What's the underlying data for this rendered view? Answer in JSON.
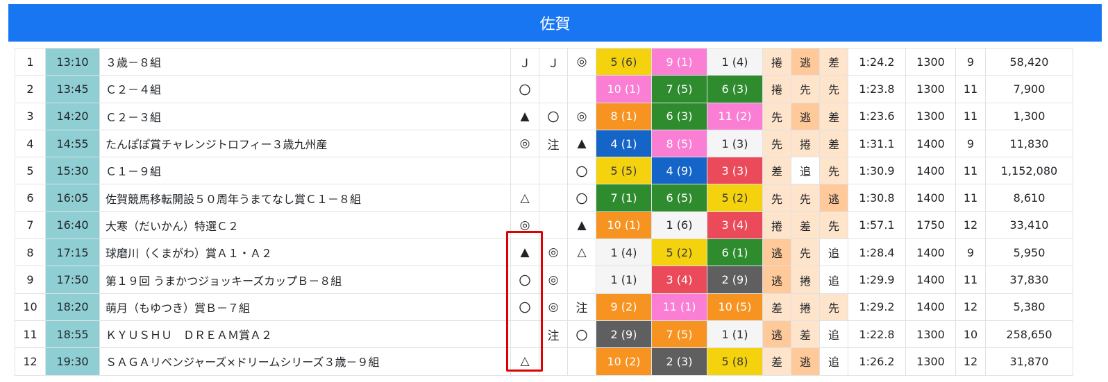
{
  "header": {
    "title": "佐賀"
  },
  "races": [
    {
      "no": "1",
      "time": "13:10",
      "name": "３歳－８組",
      "marks": [
        "Ｊ",
        "Ｊ",
        "◎"
      ],
      "results": [
        {
          "text": "5 (6)",
          "color": "yellow"
        },
        {
          "text": "9 (1)",
          "color": "pink"
        },
        {
          "text": "1 (4)",
          "color": "white"
        }
      ],
      "styles": [
        "捲",
        "逃",
        "差"
      ],
      "race_time": "1:24.2",
      "distance": "1300",
      "runners": "9",
      "payout": "58,420"
    },
    {
      "no": "2",
      "time": "13:45",
      "name": "Ｃ２－４組",
      "marks": [
        "〇",
        "",
        ""
      ],
      "results": [
        {
          "text": "10 (1)",
          "color": "pink"
        },
        {
          "text": "7 (5)",
          "color": "green"
        },
        {
          "text": "6 (3)",
          "color": "green"
        }
      ],
      "styles": [
        "捲",
        "先",
        "先"
      ],
      "race_time": "1:23.8",
      "distance": "1300",
      "runners": "11",
      "payout": "7,900"
    },
    {
      "no": "3",
      "time": "14:20",
      "name": "Ｃ２－３組",
      "marks": [
        "▲",
        "〇",
        "◎"
      ],
      "results": [
        {
          "text": "8 (1)",
          "color": "orange"
        },
        {
          "text": "6 (3)",
          "color": "green"
        },
        {
          "text": "11 (2)",
          "color": "pink"
        }
      ],
      "styles": [
        "先",
        "逃",
        "差"
      ],
      "race_time": "1:23.6",
      "distance": "1300",
      "runners": "11",
      "payout": "1,300"
    },
    {
      "no": "4",
      "time": "14:55",
      "name": "たんぽぽ賞チャレンジトロフィー３歳九州産",
      "marks": [
        "◎",
        "注",
        "▲"
      ],
      "results": [
        {
          "text": "4 (1)",
          "color": "blue"
        },
        {
          "text": "8 (5)",
          "color": "pink"
        },
        {
          "text": "1 (3)",
          "color": "white"
        }
      ],
      "styles": [
        "先",
        "捲",
        "差"
      ],
      "race_time": "1:31.1",
      "distance": "1400",
      "runners": "9",
      "payout": "11,830"
    },
    {
      "no": "5",
      "time": "15:30",
      "name": "Ｃ１－９組",
      "marks": [
        "",
        "",
        "〇"
      ],
      "results": [
        {
          "text": "5 (5)",
          "color": "yellow"
        },
        {
          "text": "4 (9)",
          "color": "blue"
        },
        {
          "text": "3 (3)",
          "color": "red"
        }
      ],
      "styles": [
        "差",
        "追",
        "先"
      ],
      "race_time": "1:30.9",
      "distance": "1400",
      "runners": "11",
      "payout": "1,152,080"
    },
    {
      "no": "6",
      "time": "16:05",
      "name": "佐賀競馬移転開設５０周年うまてなし賞Ｃ１－８組",
      "marks": [
        "△",
        "",
        "〇"
      ],
      "results": [
        {
          "text": "7 (1)",
          "color": "green"
        },
        {
          "text": "6 (5)",
          "color": "green"
        },
        {
          "text": "5 (2)",
          "color": "yellow"
        }
      ],
      "styles": [
        "先",
        "先",
        "逃"
      ],
      "race_time": "1:30.8",
      "distance": "1400",
      "runners": "11",
      "payout": "8,610"
    },
    {
      "no": "7",
      "time": "16:40",
      "name": "大寒（だいかん）特選Ｃ２",
      "marks": [
        "◎",
        "",
        "▲"
      ],
      "results": [
        {
          "text": "10 (1)",
          "color": "orange"
        },
        {
          "text": "1 (6)",
          "color": "white"
        },
        {
          "text": "3 (4)",
          "color": "red"
        }
      ],
      "styles": [
        "捲",
        "差",
        "先"
      ],
      "race_time": "1:57.1",
      "distance": "1750",
      "runners": "12",
      "payout": "33,410"
    },
    {
      "no": "8",
      "time": "17:15",
      "name": "球磨川（くまがわ）賞Ａ１・Ａ２",
      "marks": [
        "▲",
        "◎",
        "△"
      ],
      "results": [
        {
          "text": "1 (4)",
          "color": "white"
        },
        {
          "text": "5 (2)",
          "color": "yellow"
        },
        {
          "text": "6 (1)",
          "color": "green"
        }
      ],
      "styles": [
        "逃",
        "先",
        "追"
      ],
      "race_time": "1:28.4",
      "distance": "1400",
      "runners": "9",
      "payout": "5,950"
    },
    {
      "no": "9",
      "time": "17:50",
      "name": "第１９回 うまかつジョッキーズカップＢ－８組",
      "marks": [
        "〇",
        "◎",
        ""
      ],
      "results": [
        {
          "text": "1 (1)",
          "color": "white"
        },
        {
          "text": "3 (4)",
          "color": "red"
        },
        {
          "text": "2 (9)",
          "color": "gray"
        }
      ],
      "styles": [
        "逃",
        "捲",
        "追"
      ],
      "race_time": "1:29.9",
      "distance": "1400",
      "runners": "11",
      "payout": "37,830"
    },
    {
      "no": "10",
      "time": "18:20",
      "name": "萌月（もゆつき）賞Ｂ－７組",
      "marks": [
        "〇",
        "◎",
        "注"
      ],
      "results": [
        {
          "text": "9 (2)",
          "color": "orange"
        },
        {
          "text": "11 (1)",
          "color": "pink"
        },
        {
          "text": "10 (5)",
          "color": "orange"
        }
      ],
      "styles": [
        "差",
        "捲",
        "先"
      ],
      "race_time": "1:29.2",
      "distance": "1400",
      "runners": "12",
      "payout": "5,380"
    },
    {
      "no": "11",
      "time": "18:55",
      "name": "ＫＹＵＳＨＵ　ＤＲＥＡＭ賞Ａ２",
      "marks": [
        "",
        "注",
        "〇"
      ],
      "results": [
        {
          "text": "2 (9)",
          "color": "gray"
        },
        {
          "text": "7 (5)",
          "color": "orange"
        },
        {
          "text": "1 (1)",
          "color": "white"
        }
      ],
      "styles": [
        "逃",
        "差",
        "追"
      ],
      "race_time": "1:22.8",
      "distance": "1300",
      "runners": "10",
      "payout": "258,650"
    },
    {
      "no": "12",
      "time": "19:30",
      "name": "ＳＡＧＡリベンジャーズ×ドリームシリーズ３歳－９組",
      "marks": [
        "△",
        "",
        ""
      ],
      "results": [
        {
          "text": "10 (2)",
          "color": "orange"
        },
        {
          "text": "2 (3)",
          "color": "gray"
        },
        {
          "text": "5 (8)",
          "color": "yellow"
        }
      ],
      "styles": [
        "差",
        "逃",
        "追"
      ],
      "race_time": "1:26.2",
      "distance": "1300",
      "runners": "12",
      "payout": "31,870"
    }
  ],
  "colors": {
    "banner": "#1976f2",
    "time_cell": "#8fcfd4",
    "highlight_outline": "#e00000",
    "results": {
      "yellow": "#f4d20d",
      "pink": "#f97ed4",
      "green": "#2e8b2e",
      "orange": "#f79320",
      "blue": "#1564c8",
      "red": "#ea4a5a",
      "gray": "#5f5f5f",
      "white": "#f5f5f5"
    },
    "styles": {
      "捲": "#ffe4cc",
      "先": "#ffe4cc",
      "逃": "#ffc999",
      "差": "#ffe4cc",
      "追": "#ffffff"
    }
  }
}
